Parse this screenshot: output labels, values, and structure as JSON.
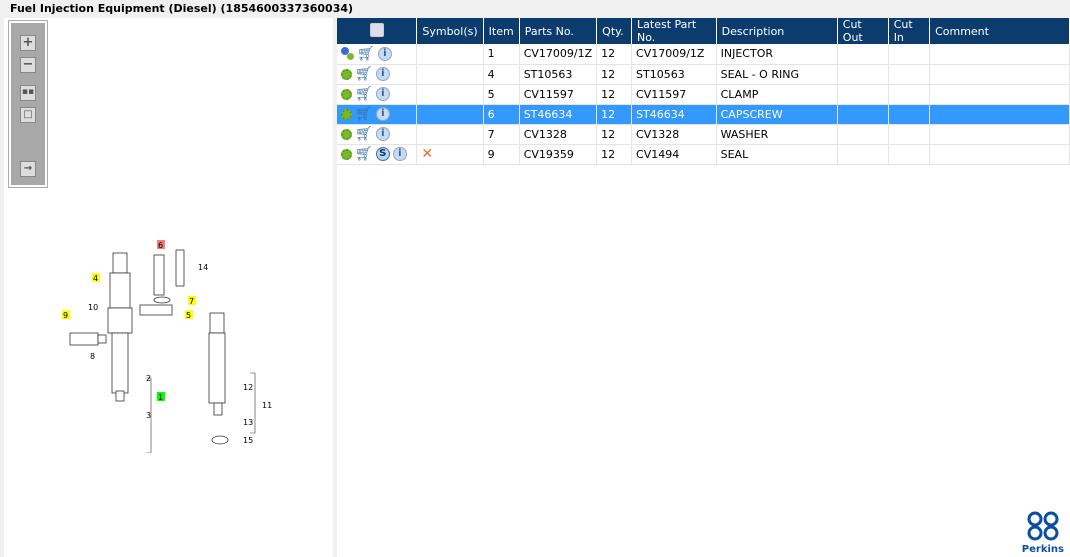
{
  "title": "Fuel Injection Equipment (Diesel) (1854600337360034)",
  "toolbar": {
    "zoom_in": "zoom-in",
    "zoom_out": "zoom-out",
    "fit": "fit",
    "actual": "actual-size",
    "panel": "toggle-panel"
  },
  "columns": [
    "",
    "Symbol(s)",
    "Item",
    "Parts No.",
    "Qty.",
    "Latest Part No.",
    "Description",
    "Cut Out",
    "Cut In",
    "Comment"
  ],
  "rows": [
    {
      "icons": [
        "gears",
        "cart",
        "info"
      ],
      "symbol": "",
      "item": "1",
      "part": "CV17009/1Z",
      "qty": "12",
      "latest": "CV17009/1Z",
      "desc": "INJECTOR",
      "cut_out": "",
      "cut_in": "",
      "comment": ""
    },
    {
      "icons": [
        "gear",
        "cart",
        "info"
      ],
      "symbol": "",
      "item": "4",
      "part": "ST10563",
      "qty": "12",
      "latest": "ST10563",
      "desc": "SEAL - O RING",
      "cut_out": "",
      "cut_in": "",
      "comment": ""
    },
    {
      "icons": [
        "gear",
        "cart",
        "info"
      ],
      "symbol": "",
      "item": "5",
      "part": "CV11597",
      "qty": "12",
      "latest": "CV11597",
      "desc": "CLAMP",
      "cut_out": "",
      "cut_in": "",
      "comment": ""
    },
    {
      "icons": [
        "gear",
        "cart",
        "info"
      ],
      "symbol": "",
      "item": "6",
      "part": "ST46634",
      "qty": "12",
      "latest": "ST46634",
      "desc": "CAPSCREW",
      "cut_out": "",
      "cut_in": "",
      "comment": "",
      "selected": true
    },
    {
      "icons": [
        "gear",
        "cart",
        "info"
      ],
      "symbol": "",
      "item": "7",
      "part": "CV1328",
      "qty": "12",
      "latest": "CV1328",
      "desc": "WASHER",
      "cut_out": "",
      "cut_in": "",
      "comment": ""
    },
    {
      "icons": [
        "gear",
        "cart",
        "s",
        "info"
      ],
      "symbol": "✕",
      "item": "9",
      "part": "CV19359",
      "qty": "12",
      "latest": "CV1494",
      "desc": "SEAL",
      "cut_out": "",
      "cut_in": "",
      "comment": ""
    }
  ],
  "callouts": {
    "c1": "1",
    "c2": "2",
    "c3": "3",
    "c4": "4",
    "c5": "5",
    "c6": "6",
    "c7": "7",
    "c8": "8",
    "c9": "9",
    "c10": "10",
    "c11": "11",
    "c12": "12",
    "c13": "13",
    "c14": "14",
    "c15": "15"
  },
  "colors": {
    "header": "#0c3b6e",
    "selected": "#3399ff",
    "highlight_yellow": "#ffff00",
    "highlight_red": "#f08080",
    "highlight_green": "#00ff00"
  },
  "logo": "Perkins"
}
